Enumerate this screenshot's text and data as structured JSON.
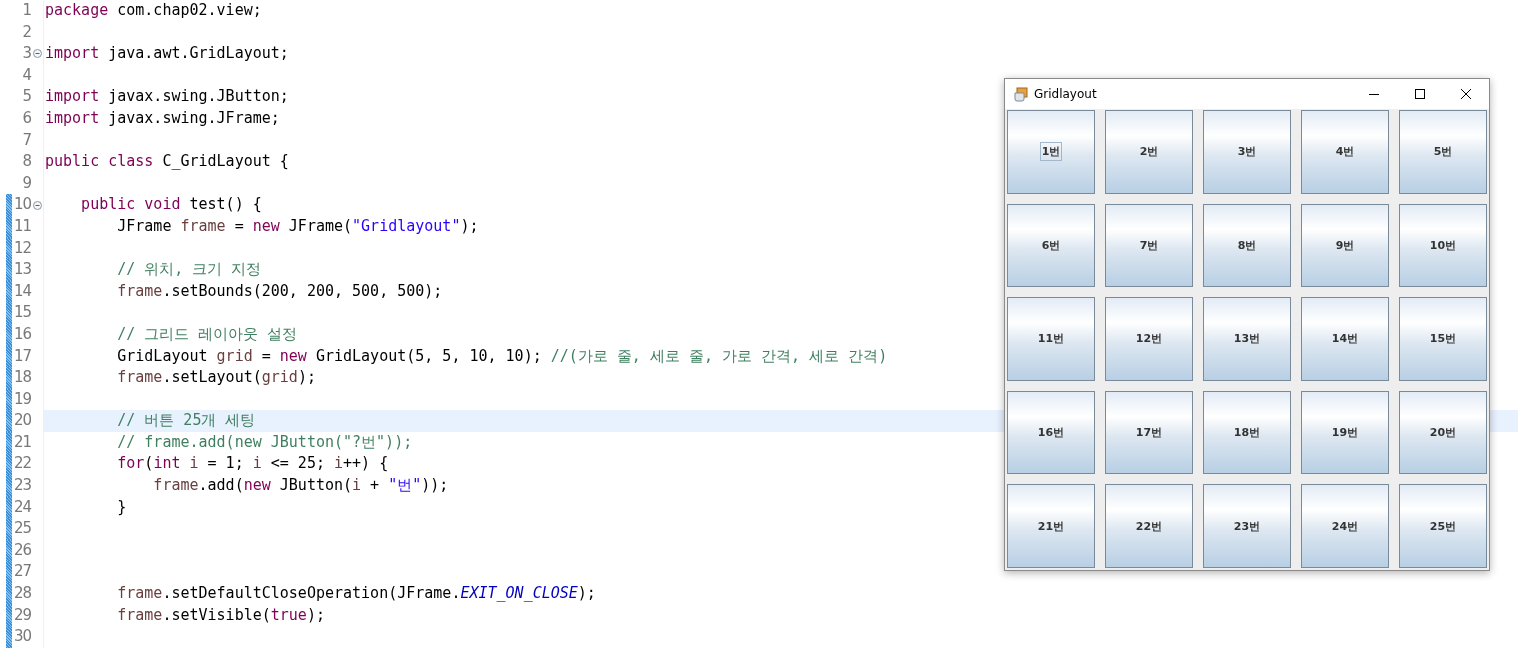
{
  "editor": {
    "lines": [
      {
        "number": "1",
        "fold": false,
        "changed": false,
        "current": false,
        "tokens": [
          {
            "kind": "kw",
            "text": "package"
          },
          {
            "kind": "plain",
            "text": " com.chap02.view;"
          }
        ]
      },
      {
        "number": "2",
        "fold": false,
        "changed": false,
        "current": false
      },
      {
        "number": "3",
        "fold": true,
        "changed": false,
        "current": false,
        "tokens": [
          {
            "kind": "kw",
            "text": "import"
          },
          {
            "kind": "plain",
            "text": " java.awt.GridLayout;"
          }
        ]
      },
      {
        "number": "4",
        "fold": false,
        "changed": false,
        "current": false
      },
      {
        "number": "5",
        "fold": false,
        "changed": false,
        "current": false,
        "tokens": [
          {
            "kind": "kw",
            "text": "import"
          },
          {
            "kind": "plain",
            "text": " javax.swing.JButton;"
          }
        ]
      },
      {
        "number": "6",
        "fold": false,
        "changed": false,
        "current": false,
        "tokens": [
          {
            "kind": "kw",
            "text": "import"
          },
          {
            "kind": "plain",
            "text": " javax.swing.JFrame;"
          }
        ]
      },
      {
        "number": "7",
        "fold": false,
        "changed": false,
        "current": false
      },
      {
        "number": "8",
        "fold": false,
        "changed": false,
        "current": false,
        "tokens": [
          {
            "kind": "kw",
            "text": "public"
          },
          {
            "kind": "kw",
            "text": " class"
          },
          {
            "kind": "plain",
            "text": " C_GridLayout {"
          }
        ]
      },
      {
        "number": "9",
        "fold": false,
        "changed": false,
        "current": false
      },
      {
        "number": "10",
        "fold": true,
        "changed": true,
        "current": false,
        "tokens": [
          {
            "kind": "kw",
            "text": "    public"
          },
          {
            "kind": "kw",
            "text": " void"
          },
          {
            "kind": "plain",
            "text": " test() {"
          }
        ]
      },
      {
        "number": "11",
        "fold": false,
        "changed": true,
        "current": false,
        "tokens": [
          {
            "kind": "plain",
            "text": "        JFrame "
          },
          {
            "kind": "var",
            "text": "frame"
          },
          {
            "kind": "plain",
            "text": " = "
          },
          {
            "kind": "kw",
            "text": "new"
          },
          {
            "kind": "plain",
            "text": " JFrame("
          },
          {
            "kind": "str",
            "text": "\"Gridlayout\""
          },
          {
            "kind": "plain",
            "text": ");"
          }
        ]
      },
      {
        "number": "12",
        "fold": false,
        "changed": true,
        "current": false
      },
      {
        "number": "13",
        "fold": false,
        "changed": true,
        "current": false,
        "tokens": [
          {
            "kind": "cmt",
            "text": "        // 위치, 크기 지정"
          }
        ]
      },
      {
        "number": "14",
        "fold": false,
        "changed": true,
        "current": false,
        "tokens": [
          {
            "kind": "var",
            "text": "        frame"
          },
          {
            "kind": "plain",
            "text": ".setBounds(200, 200, 500, 500);"
          }
        ]
      },
      {
        "number": "15",
        "fold": false,
        "changed": true,
        "current": false
      },
      {
        "number": "16",
        "fold": false,
        "changed": true,
        "current": false,
        "tokens": [
          {
            "kind": "cmt",
            "text": "        // 그리드 레이아웃 설정"
          }
        ]
      },
      {
        "number": "17",
        "fold": false,
        "changed": true,
        "current": false,
        "tokens": [
          {
            "kind": "plain",
            "text": "        GridLayout "
          },
          {
            "kind": "var",
            "text": "grid"
          },
          {
            "kind": "plain",
            "text": " = "
          },
          {
            "kind": "kw",
            "text": "new"
          },
          {
            "kind": "plain",
            "text": " GridLayout(5, 5, 10, 10); "
          },
          {
            "kind": "cmt",
            "text": "//(가로 줄, 세로 줄, 가로 간격, 세로 간격)"
          }
        ]
      },
      {
        "number": "18",
        "fold": false,
        "changed": true,
        "current": false,
        "tokens": [
          {
            "kind": "var",
            "text": "        frame"
          },
          {
            "kind": "plain",
            "text": ".setLayout("
          },
          {
            "kind": "var",
            "text": "grid"
          },
          {
            "kind": "plain",
            "text": ");"
          }
        ]
      },
      {
        "number": "19",
        "fold": false,
        "changed": true,
        "current": false
      },
      {
        "number": "20",
        "fold": false,
        "changed": true,
        "current": true,
        "tokens": [
          {
            "kind": "cmt",
            "text": "        // 버튼 25개 세팅"
          }
        ]
      },
      {
        "number": "21",
        "fold": false,
        "changed": true,
        "current": false,
        "tokens": [
          {
            "kind": "cmt",
            "text": "        // frame.add(new JButton(\"?번\"));"
          }
        ]
      },
      {
        "number": "22",
        "fold": false,
        "changed": true,
        "current": false,
        "tokens": [
          {
            "kind": "kw",
            "text": "        for"
          },
          {
            "kind": "plain",
            "text": "("
          },
          {
            "kind": "kw",
            "text": "int"
          },
          {
            "kind": "var",
            "text": " i"
          },
          {
            "kind": "plain",
            "text": " = 1; "
          },
          {
            "kind": "var",
            "text": "i"
          },
          {
            "kind": "plain",
            "text": " <= 25; "
          },
          {
            "kind": "var",
            "text": "i"
          },
          {
            "kind": "plain",
            "text": "++) {"
          }
        ]
      },
      {
        "number": "23",
        "fold": false,
        "changed": true,
        "current": false,
        "tokens": [
          {
            "kind": "var",
            "text": "            frame"
          },
          {
            "kind": "plain",
            "text": ".add("
          },
          {
            "kind": "kw",
            "text": "new"
          },
          {
            "kind": "plain",
            "text": " JButton("
          },
          {
            "kind": "var",
            "text": "i"
          },
          {
            "kind": "plain",
            "text": " + "
          },
          {
            "kind": "str",
            "text": "\"번\""
          },
          {
            "kind": "plain",
            "text": "));"
          }
        ]
      },
      {
        "number": "24",
        "fold": false,
        "changed": true,
        "current": false,
        "tokens": [
          {
            "kind": "plain",
            "text": "        }"
          }
        ]
      },
      {
        "number": "25",
        "fold": false,
        "changed": true,
        "current": false
      },
      {
        "number": "26",
        "fold": false,
        "changed": true,
        "current": false
      },
      {
        "number": "27",
        "fold": false,
        "changed": true,
        "current": false
      },
      {
        "number": "28",
        "fold": false,
        "changed": true,
        "current": false,
        "tokens": [
          {
            "kind": "var",
            "text": "        frame"
          },
          {
            "kind": "plain",
            "text": ".setDefaultCloseOperation(JFrame."
          },
          {
            "kind": "field",
            "text": "EXIT_ON_CLOSE"
          },
          {
            "kind": "plain",
            "text": ");"
          }
        ]
      },
      {
        "number": "29",
        "fold": false,
        "changed": true,
        "current": false,
        "tokens": [
          {
            "kind": "var",
            "text": "        frame"
          },
          {
            "kind": "plain",
            "text": ".setVisible("
          },
          {
            "kind": "kw",
            "text": "true"
          },
          {
            "kind": "plain",
            "text": ");"
          }
        ]
      },
      {
        "number": "30",
        "fold": false,
        "changed": true,
        "current": false
      }
    ]
  },
  "window": {
    "title": "Gridlayout",
    "buttons": [
      {
        "label": "1번",
        "focused": true
      },
      {
        "label": "2번",
        "focused": false
      },
      {
        "label": "3번",
        "focused": false
      },
      {
        "label": "4번",
        "focused": false
      },
      {
        "label": "5번",
        "focused": false
      },
      {
        "label": "6번",
        "focused": false
      },
      {
        "label": "7번",
        "focused": false
      },
      {
        "label": "8번",
        "focused": false
      },
      {
        "label": "9번",
        "focused": false
      },
      {
        "label": "10번",
        "focused": false
      },
      {
        "label": "11번",
        "focused": false
      },
      {
        "label": "12번",
        "focused": false
      },
      {
        "label": "13번",
        "focused": false
      },
      {
        "label": "14번",
        "focused": false
      },
      {
        "label": "15번",
        "focused": false
      },
      {
        "label": "16번",
        "focused": false
      },
      {
        "label": "17번",
        "focused": false
      },
      {
        "label": "18번",
        "focused": false
      },
      {
        "label": "19번",
        "focused": false
      },
      {
        "label": "20번",
        "focused": false
      },
      {
        "label": "21번",
        "focused": false
      },
      {
        "label": "22번",
        "focused": false
      },
      {
        "label": "23번",
        "focused": false
      },
      {
        "label": "24번",
        "focused": false
      },
      {
        "label": "25번",
        "focused": false
      }
    ]
  }
}
